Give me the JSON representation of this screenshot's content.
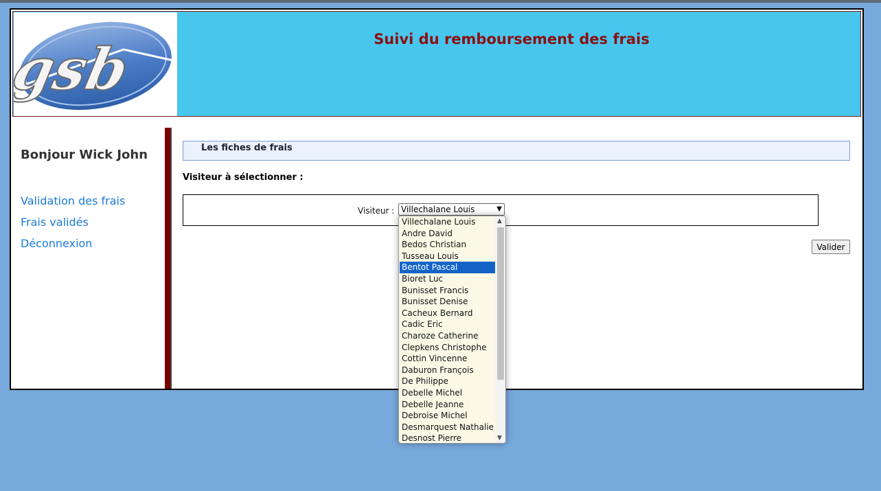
{
  "header": {
    "title": "Suivi du remboursement des frais",
    "logo_text": "gsb"
  },
  "sidebar": {
    "greeting": "Bonjour Wick John",
    "links": [
      {
        "label": "Validation des frais"
      },
      {
        "label": "Frais validés"
      },
      {
        "label": "Déconnexion"
      }
    ]
  },
  "main": {
    "section_title": "Les fiches de frais",
    "select_heading": "Visiteur à sélectionner :",
    "visiteur_label": "Visiteur :",
    "selected_value": "Villechalane Louis",
    "submit_label": "Valider"
  },
  "dropdown": {
    "highlighted_index": 4,
    "options": [
      "Villechalane Louis",
      "Andre David",
      "Bedos Christian",
      "Tusseau Louis",
      "Bentot Pascal",
      "Bioret Luc",
      "Bunisset Francis",
      "Bunisset Denise",
      "Cacheux Bernard",
      "Cadic Eric",
      "Charoze Catherine",
      "Clepkens Christophe",
      "Cottin Vincenne",
      "Daburon François",
      "De Philippe",
      "Debelle Michel",
      "Debelle Jeanne",
      "Debroise Michel",
      "Desmarquest Nathalie",
      "Desnost Pierre"
    ]
  },
  "colors": {
    "background": "#77a9dc",
    "header": "#48c6ee",
    "title": "#8b1010",
    "link": "#1a7ad6",
    "highlight": "#1464c8"
  }
}
